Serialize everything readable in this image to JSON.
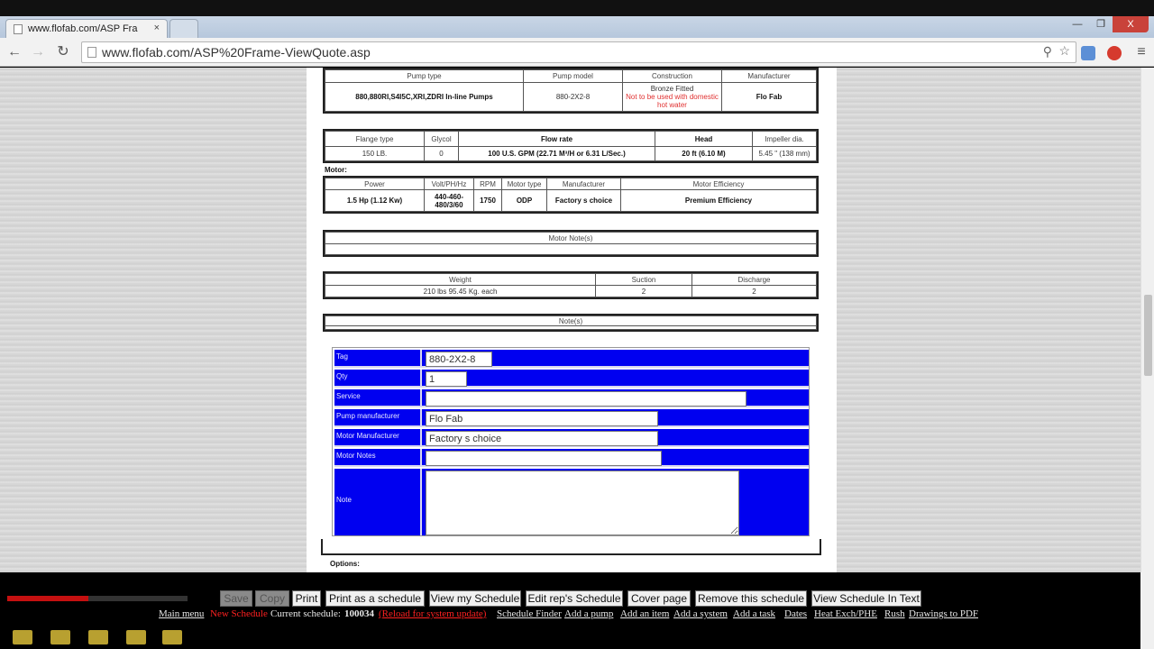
{
  "browser": {
    "tab_title": "www.flofab.com/ASP Fra",
    "tab_close": "×",
    "url": "www.flofab.com/ASP%20Frame-ViewQuote.asp",
    "back": "←",
    "forward": "→",
    "reload": "↻",
    "win_minimize": "—",
    "win_restore": "❐",
    "win_close": "X",
    "search_glyph": "⚲",
    "star_glyph": "☆",
    "menu_glyph": "≡"
  },
  "pump_table": {
    "headers": [
      "Pump type",
      "Pump model",
      "Construction",
      "Manufacturer"
    ],
    "pump_type": "880,880RI,S4I5C,XRI,ZDRI In-line Pumps",
    "pump_model": "880-2X2-8",
    "construction_main": "Bronze Fitted",
    "construction_warning": "Not to be used with domestic hot water",
    "manufacturer": "Flo Fab"
  },
  "flow_table": {
    "headers": [
      "Flange type",
      "Glycol",
      "Flow rate",
      "Head",
      "Impeller dia."
    ],
    "flange": "150 LB.",
    "glycol": "0",
    "flow": "100 U.S. GPM (22.71 M³/H or 6.31 L/Sec.)",
    "head": "20 ft (6.10 M)",
    "impeller": "5.45 \" (138 mm)"
  },
  "motor_label": "Motor:",
  "motor_table": {
    "headers": [
      "Power",
      "Volt/PH/Hz",
      "RPM",
      "Motor type",
      "Manufacturer",
      "Motor Efficiency"
    ],
    "power": "1.5 Hp (1.12 Kw)",
    "volt": "440-460-480/3/60",
    "rpm": "1750",
    "type": "ODP",
    "manufacturer": "Factory s choice",
    "efficiency": "Premium Efficiency"
  },
  "motor_notes_header": "Motor Note(s)",
  "weight_table": {
    "headers": [
      "Weight",
      "Suction",
      "Discharge"
    ],
    "weight": "210 lbs 95.45 Kg. each",
    "suction": "2",
    "discharge": "2"
  },
  "notes_header": "Note(s)",
  "form": {
    "tag_label": "Tag",
    "tag_value": "880-2X2-8",
    "qty_label": "Qty",
    "qty_value": "1",
    "service_label": "Service",
    "service_value": "",
    "pump_mfr_label": "Pump manufacturer",
    "pump_mfr_value": "Flo Fab",
    "motor_mfr_label": "Motor Manufacturer",
    "motor_mfr_value": "Factory s choice",
    "motor_notes_label": "Motor Notes",
    "motor_notes_value": "",
    "note_label": "Note",
    "note_value": ""
  },
  "options_label": "Options:",
  "actions": {
    "save": "Save",
    "copy": "Copy",
    "print": "Print",
    "print_schedule": "Print as a schedule",
    "view_schedule": "View my Schedule",
    "edit_rep": "Edit rep's Schedule",
    "cover": "Cover page",
    "remove": "Remove this schedule",
    "view_text": "View Schedule In Text"
  },
  "links": {
    "main_menu": "Main menu",
    "new_schedule": "New Schedule",
    "current_schedule_prefix": "Current schedule:",
    "current_schedule_id": "100034",
    "reload": "(Reload for system update)",
    "finder": "Schedule Finder",
    "add_pump": "Add a pump",
    "add_item": "Add an item",
    "add_system": "Add a system",
    "add_task": "Add a task",
    "dates": "Dates",
    "heat": "Heat Exch/PHE",
    "rush": "Rush",
    "drawings": "Drawings to PDF"
  },
  "player": {
    "progress_percent": 45
  }
}
